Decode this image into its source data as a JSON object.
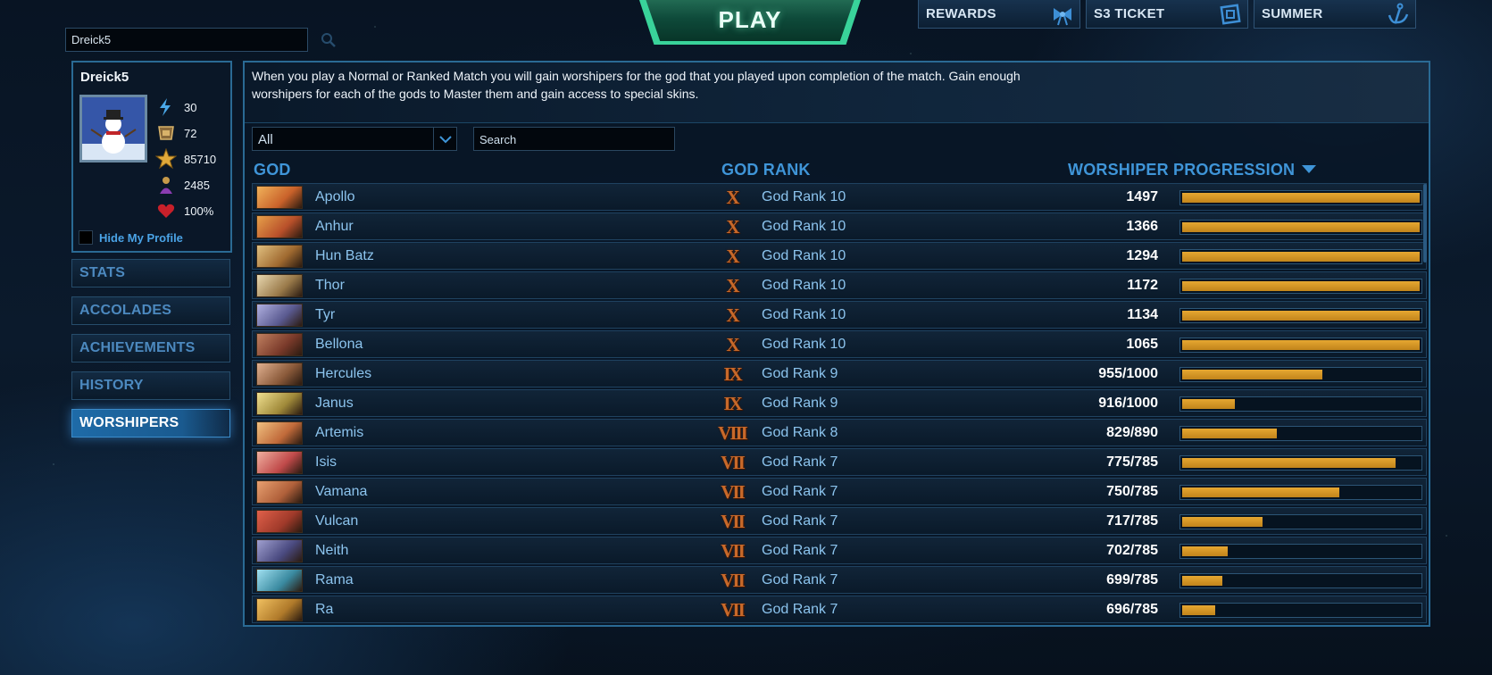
{
  "header": {
    "player_search_value": "Dreick5",
    "play_label": "PLAY",
    "tabs": [
      {
        "label": "REWARDS",
        "icon": "ribbon-icon"
      },
      {
        "label": "S3 TICKET",
        "icon": "ticket-icon"
      },
      {
        "label": "SUMMER",
        "icon": "anchor-icon"
      }
    ]
  },
  "profile": {
    "name": "Dreick5",
    "avatar": "snowman-avatar",
    "stats": [
      {
        "icon": "level-icon",
        "value": "30"
      },
      {
        "icon": "mastery-icon",
        "value": "72"
      },
      {
        "icon": "star-icon",
        "value": "85710"
      },
      {
        "icon": "worshiper-icon",
        "value": "2485"
      },
      {
        "icon": "heart-icon",
        "value": "100%"
      }
    ],
    "hide_label": "Hide My Profile"
  },
  "sidebar": {
    "items": [
      {
        "label": "STATS",
        "active": false
      },
      {
        "label": "ACCOLADES",
        "active": false
      },
      {
        "label": "ACHIEVEMENTS",
        "active": false
      },
      {
        "label": "HISTORY",
        "active": false
      },
      {
        "label": "WORSHIPERS",
        "active": true
      }
    ]
  },
  "main": {
    "description": "When you play a Normal or Ranked Match you will gain worshipers for the god that you played upon completion of the match.  Gain enough worshipers for each of the gods to Master them and gain access to special skins.",
    "filter_value": "All",
    "search_placeholder": "Search",
    "columns": {
      "god": "GOD",
      "rank": "GOD RANK",
      "progress": "WORSHIPER PROGRESSION"
    },
    "colors": {
      "accent": "#3f95d8",
      "bar": "#d99a27"
    },
    "gods": [
      {
        "name": "Apollo",
        "numeral": "X",
        "rank": "God Rank 10",
        "progress": "1497",
        "fill": 1.0
      },
      {
        "name": "Anhur",
        "numeral": "X",
        "rank": "God Rank 10",
        "progress": "1366",
        "fill": 1.0
      },
      {
        "name": "Hun Batz",
        "numeral": "X",
        "rank": "God Rank 10",
        "progress": "1294",
        "fill": 1.0
      },
      {
        "name": "Thor",
        "numeral": "X",
        "rank": "God Rank 10",
        "progress": "1172",
        "fill": 1.0
      },
      {
        "name": "Tyr",
        "numeral": "X",
        "rank": "God Rank 10",
        "progress": "1134",
        "fill": 1.0
      },
      {
        "name": "Bellona",
        "numeral": "X",
        "rank": "God Rank 10",
        "progress": "1065",
        "fill": 1.0
      },
      {
        "name": "Hercules",
        "numeral": "IX",
        "rank": "God Rank 9",
        "progress": "955/1000",
        "fill": 0.59
      },
      {
        "name": "Janus",
        "numeral": "IX",
        "rank": "God Rank 9",
        "progress": "916/1000",
        "fill": 0.22
      },
      {
        "name": "Artemis",
        "numeral": "VIII",
        "rank": "God Rank 8",
        "progress": "829/890",
        "fill": 0.4
      },
      {
        "name": "Isis",
        "numeral": "VII",
        "rank": "God Rank 7",
        "progress": "775/785",
        "fill": 0.9
      },
      {
        "name": "Vamana",
        "numeral": "VII",
        "rank": "God Rank 7",
        "progress": "750/785",
        "fill": 0.66
      },
      {
        "name": "Vulcan",
        "numeral": "VII",
        "rank": "God Rank 7",
        "progress": "717/785",
        "fill": 0.34
      },
      {
        "name": "Neith",
        "numeral": "VII",
        "rank": "God Rank 7",
        "progress": "702/785",
        "fill": 0.19
      },
      {
        "name": "Rama",
        "numeral": "VII",
        "rank": "God Rank 7",
        "progress": "699/785",
        "fill": 0.17
      },
      {
        "name": "Ra",
        "numeral": "VII",
        "rank": "God Rank 7",
        "progress": "696/785",
        "fill": 0.14
      }
    ]
  }
}
